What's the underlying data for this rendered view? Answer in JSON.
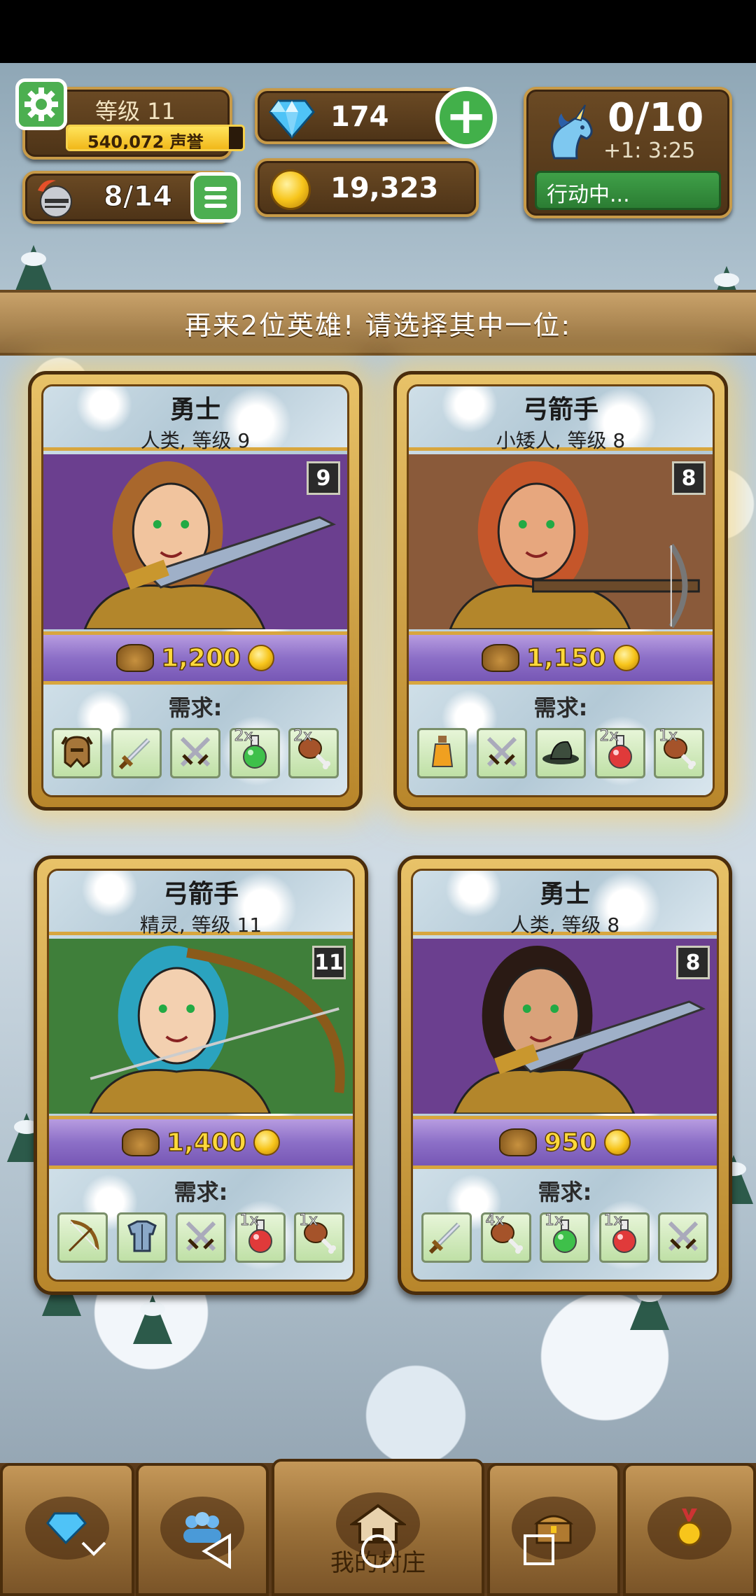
{
  "hud": {
    "level_label": "等级 11",
    "reputation": "540,072 声誉",
    "reputation_fill": 0.92,
    "heroes": "8/14",
    "gems": "174",
    "gold": "19,323",
    "action_points": "0/10",
    "action_timer": "+1: 3:25",
    "action_status": "行动中..."
  },
  "banner": {
    "text": "再来2位英雄! 请选择其中一位:"
  },
  "cards": [
    {
      "class": "勇士",
      "race": "人类, 等级 9",
      "level": "9",
      "price": "1,200",
      "req_label": "需求:",
      "reqs": [
        {
          "icon": "helmet-icon",
          "count": ""
        },
        {
          "icon": "sword-icon",
          "count": ""
        },
        {
          "icon": "crossed-swords-icon",
          "count": ""
        },
        {
          "icon": "green-potion-icon",
          "count": "2x"
        },
        {
          "icon": "meat-icon",
          "count": "2x"
        }
      ]
    },
    {
      "class": "弓箭手",
      "race": "小矮人, 等级 8",
      "level": "8",
      "price": "1,150",
      "req_label": "需求:",
      "reqs": [
        {
          "icon": "orange-potion-icon",
          "count": ""
        },
        {
          "icon": "crossed-swords-icon",
          "count": ""
        },
        {
          "icon": "hat-icon",
          "count": ""
        },
        {
          "icon": "red-potion-icon",
          "count": "2x"
        },
        {
          "icon": "meat-icon",
          "count": "1x"
        }
      ]
    },
    {
      "class": "弓箭手",
      "race": "精灵, 等级 11",
      "level": "11",
      "price": "1,400",
      "req_label": "需求:",
      "reqs": [
        {
          "icon": "bow-icon",
          "count": ""
        },
        {
          "icon": "armor-icon",
          "count": ""
        },
        {
          "icon": "crossed-swords-icon",
          "count": ""
        },
        {
          "icon": "red-potion-icon",
          "count": "1x"
        },
        {
          "icon": "meat-icon",
          "count": "1x"
        }
      ]
    },
    {
      "class": "勇士",
      "race": "人类, 等级 8",
      "level": "8",
      "price": "950",
      "req_label": "需求:",
      "reqs": [
        {
          "icon": "sword-icon",
          "count": ""
        },
        {
          "icon": "meat-icon",
          "count": "4x"
        },
        {
          "icon": "green-potion-icon",
          "count": "1x"
        },
        {
          "icon": "red-potion-icon",
          "count": "1x"
        },
        {
          "icon": "crossed-swords-icon",
          "count": ""
        }
      ]
    }
  ],
  "nav": {
    "village_label": "我的村庄"
  }
}
